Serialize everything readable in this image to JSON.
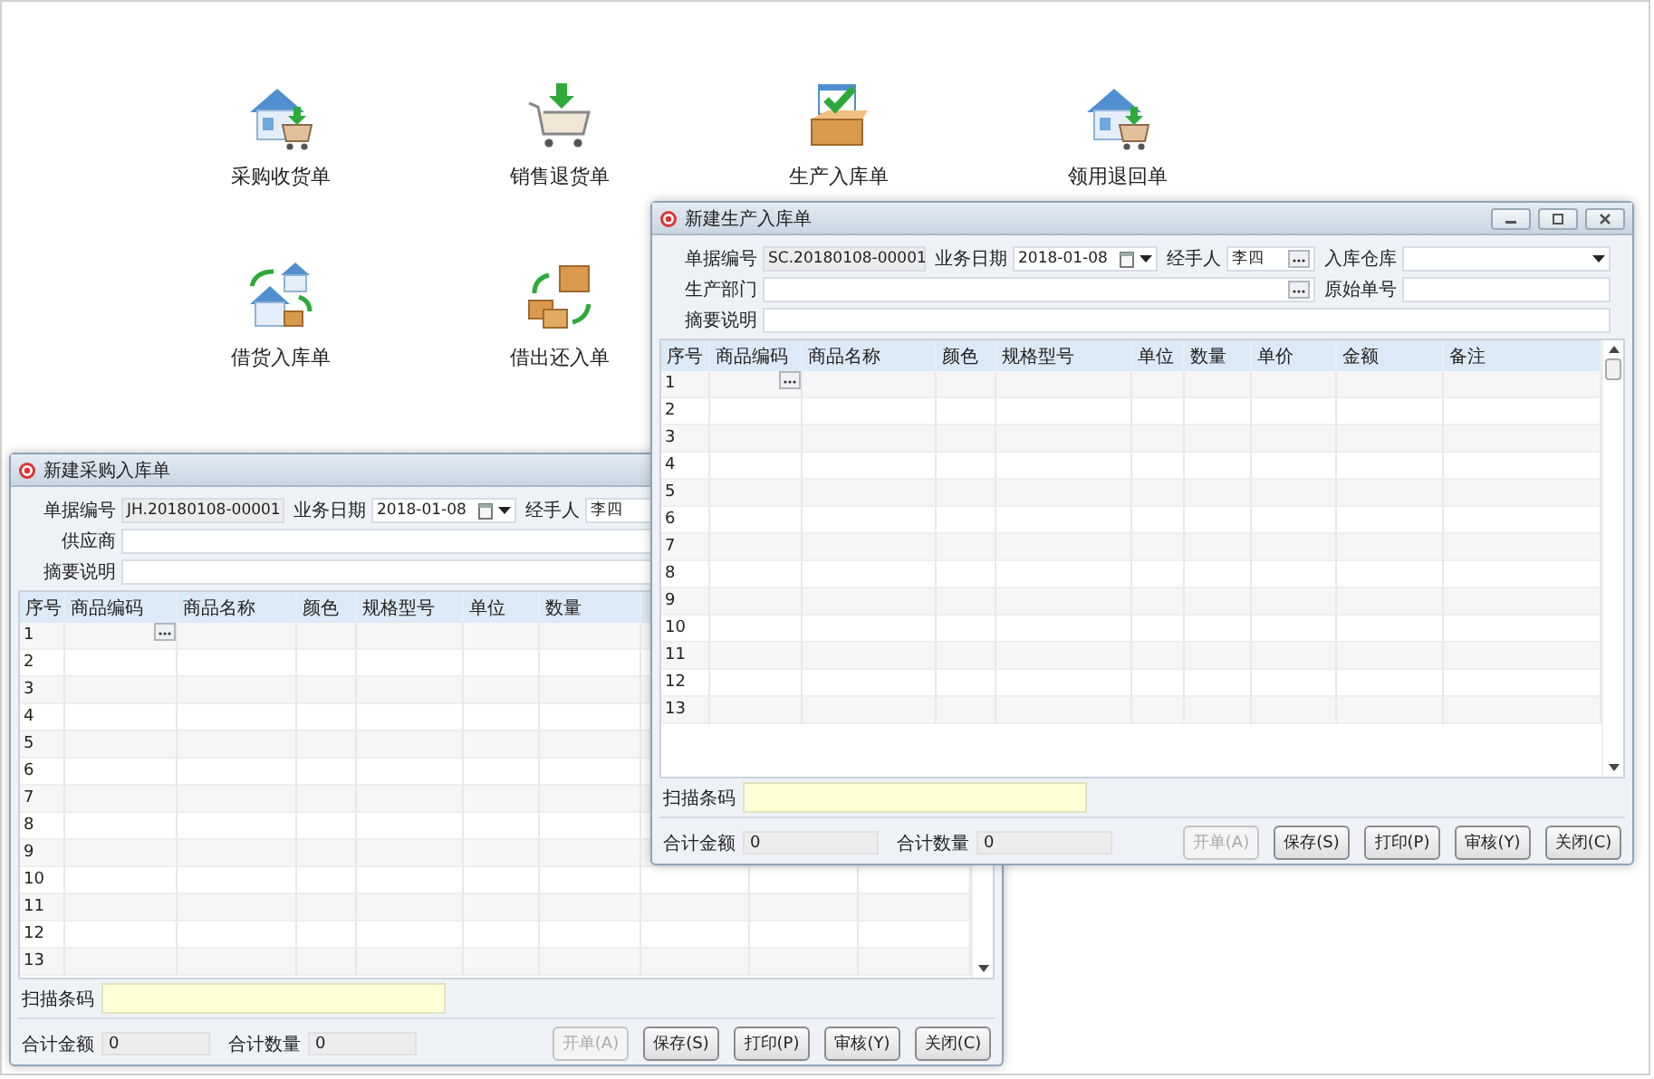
{
  "launchers": [
    {
      "label": "采购收货单",
      "kind": "house-cart"
    },
    {
      "label": "销售退货单",
      "kind": "cart-down"
    },
    {
      "label": "生产入库单",
      "kind": "box-check"
    },
    {
      "label": "领用退回单",
      "kind": "house-cart"
    },
    {
      "label": "借货入库单",
      "kind": "houses-arrows"
    },
    {
      "label": "借出还入单",
      "kind": "boxes-arrows"
    }
  ],
  "windows": [
    {
      "title": "新建采购入库单",
      "form_rows": [
        [
          {
            "label": "单据编号",
            "kind": "readonly",
            "value": "JH.20180108-00001"
          },
          {
            "label": "业务日期",
            "kind": "date",
            "value": "2018-01-08"
          },
          {
            "label": "经手人",
            "kind": "lookup",
            "value": "李四"
          }
        ],
        [
          {
            "label": "供应商",
            "kind": "lookup"
          }
        ],
        [
          {
            "label": "摘要说明",
            "kind": "text"
          }
        ]
      ],
      "columns": [
        "序号",
        "商品编码",
        "商品名称",
        "颜色",
        "规格型号",
        "单位",
        "数量"
      ],
      "rows": [
        "1",
        "2",
        "3",
        "4",
        "5",
        "6",
        "7",
        "8",
        "9",
        "10",
        "11",
        "12",
        "13"
      ],
      "barcode_label": "扫描条码",
      "totals": [
        {
          "label": "合计金额",
          "value": "0"
        },
        {
          "label": "合计数量",
          "value": "0"
        }
      ],
      "buttons": [
        {
          "label": "开单(A)",
          "disabled": true
        },
        {
          "label": "保存(S)",
          "disabled": false
        },
        {
          "label": "打印(P)",
          "disabled": false
        },
        {
          "label": "审核(Y)",
          "disabled": false
        },
        {
          "label": "关闭(C)",
          "disabled": false
        }
      ]
    },
    {
      "title": "新建生产入库单",
      "window_buttons": true,
      "form_rows": [
        [
          {
            "label": "单据编号",
            "kind": "readonly",
            "value": "SC.20180108-00001"
          },
          {
            "label": "业务日期",
            "kind": "date",
            "value": "2018-01-08"
          },
          {
            "label": "经手人",
            "kind": "lookup",
            "value": "李四"
          },
          {
            "label": "入库仓库",
            "kind": "select"
          }
        ],
        [
          {
            "label": "生产部门",
            "kind": "lookup"
          },
          {
            "label": "原始单号",
            "kind": "text"
          }
        ],
        [
          {
            "label": "摘要说明",
            "kind": "text"
          }
        ]
      ],
      "columns": [
        "序号",
        "商品编码",
        "商品名称",
        "颜色",
        "规格型号",
        "单位",
        "数量",
        "单价",
        "金额",
        "备注"
      ],
      "rows": [
        "1",
        "2",
        "3",
        "4",
        "5",
        "6",
        "7",
        "8",
        "9",
        "10",
        "11",
        "12",
        "13"
      ],
      "barcode_label": "扫描条码",
      "totals": [
        {
          "label": "合计金额",
          "value": "0"
        },
        {
          "label": "合计数量",
          "value": "0"
        }
      ],
      "buttons": [
        {
          "label": "开单(A)",
          "disabled": true
        },
        {
          "label": "保存(S)",
          "disabled": false
        },
        {
          "label": "打印(P)",
          "disabled": false
        },
        {
          "label": "审核(Y)",
          "disabled": false
        },
        {
          "label": "关闭(C)",
          "disabled": false
        }
      ]
    }
  ]
}
